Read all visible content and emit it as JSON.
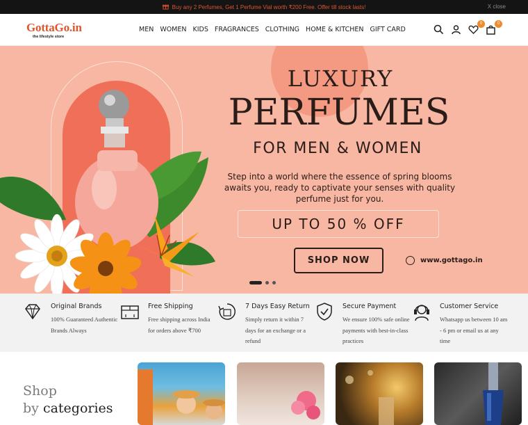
{
  "topbar": {
    "promo": "Buy any 2 Perfumes, Get 1 Perfume Vial worth ₹200 Free. Offer till stock lasts!",
    "close_label": "X close"
  },
  "header": {
    "logo": {
      "name": "GottaGo.in",
      "tagline": "the lifestyle store"
    },
    "nav": [
      "MEN",
      "WOMEN",
      "KIDS",
      "FRAGRANCES",
      "CLOTHING",
      "HOME & KITCHEN",
      "GIFT CARD"
    ],
    "wishlist_count": "0",
    "cart_count": "0"
  },
  "hero": {
    "line1": "LUXURY",
    "line2": "PERFUMES",
    "line3": "FOR MEN & WOMEN",
    "description": "Step into a world where the essence of spring blooms awaits you, ready to captivate your senses with quality perfume just for you.",
    "offer": "UP TO 50 % OFF",
    "cta": "SHOP NOW",
    "website": "www.gottago.in",
    "slides": 3,
    "active_slide": 1
  },
  "features": [
    {
      "icon": "diamond-icon",
      "title": "Original Brands",
      "desc": "100% Guaranteed Authentic Brands Always"
    },
    {
      "icon": "delivery-box-icon",
      "title": "Free Shipping",
      "desc": "Free shipping across India for orders above ₹700"
    },
    {
      "icon": "return-box-icon",
      "title": "7 Days Easy Return",
      "desc": "Simply return it within 7 days for an exchange or a refund"
    },
    {
      "icon": "shield-check-icon",
      "title": "Secure Payment",
      "desc": "We ensure 100% safe online payments with best-in-class practices"
    },
    {
      "icon": "headset-icon",
      "title": "Customer Service",
      "desc": "Whatsapp us between 10 am - 6 pm or email us at any time"
    }
  ],
  "categories": {
    "heading_light": "Shop",
    "heading_prefix": "by",
    "heading_bold": "categories"
  },
  "colors": {
    "brand": "#e0552e",
    "hero_bg": "#f8b7a2",
    "badge": "#f08a2a",
    "text_dark": "#2a1c18"
  }
}
